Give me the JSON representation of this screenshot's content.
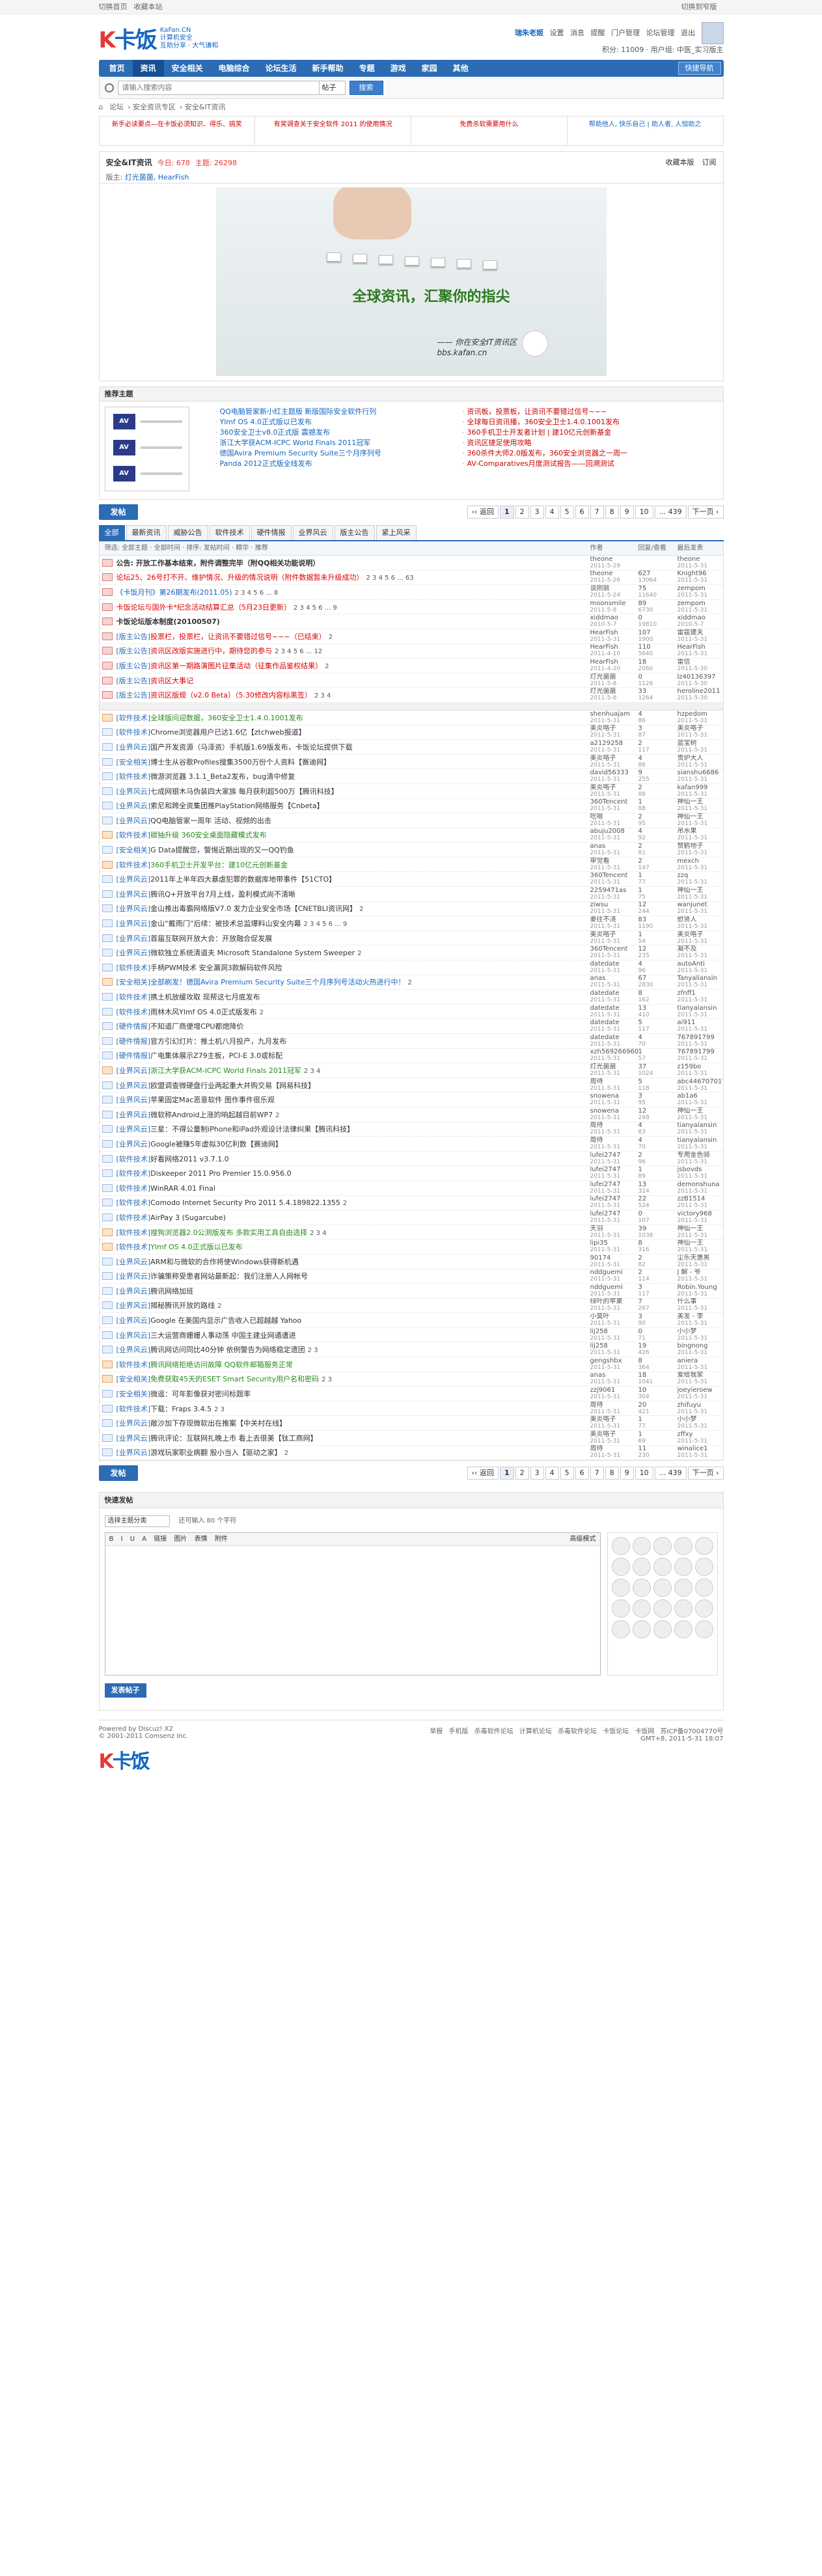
{
  "topbar": {
    "left": [
      "切换首页",
      "收藏本站"
    ],
    "right": "切换到窄版"
  },
  "logo": {
    "brand": "K卡饭",
    "sub1": "KaFan.CN",
    "sub2": "计算机安全",
    "sub3": "互助分享 · 大气谦和"
  },
  "user": {
    "name": "瑞朱老姬",
    "links": [
      "设置",
      "消息",
      "提醒",
      "门户管理",
      "论坛管理",
      "退出"
    ],
    "line2": "积分: 11009 · 用户组: 中医_实习版主"
  },
  "nav": {
    "items": [
      "首页",
      "资讯",
      "安全相关",
      "电脑综合",
      "论坛生活",
      "新手帮助",
      "专题",
      "游戏",
      "家园",
      "其他"
    ],
    "active": "资讯",
    "quick": "快捷导航"
  },
  "search": {
    "placeholder": "请输入搜索内容",
    "scope": "帖子",
    "button": "搜索"
  },
  "breadcrumb": [
    "论坛",
    "安全资讯专区",
    "安全&IT资讯"
  ],
  "banners": [
    "新手必读要点—在卡饭必须知识、得乐、搞笑",
    "有奖调查关于安全软件 2011 的使用情况",
    "免费杀软需要用什么",
    "帮助他人, 快乐自己 | 助人者, 人恒助之"
  ],
  "forum": {
    "title": "安全&IT资讯",
    "today": "今日: 678",
    "threads": "主题: 26298",
    "moderators_label": "版主:",
    "moderators": "灯光菌菌, HearFish",
    "fav": "收藏本版",
    "rss": "订阅"
  },
  "hero": {
    "slogan": "全球资讯，汇聚你的指尖",
    "caption1": "—— 你在安全IT资讯区",
    "caption2": "bbs.kafan.cn"
  },
  "theme": {
    "title": "推荐主题",
    "left": [
      "QQ电脑管家新小红主题版 新版国际安全软件行列",
      "Ylmf OS 4.0正式版以已发布",
      "360安全卫士v8.0正式版 震撼发布",
      "浙江大学获ACM-ICPC World Finals 2011冠军",
      "德国Avira Premium Security Suite三个月序列号",
      "Panda 2012正式版全线发布"
    ],
    "right": [
      "资讯板，投票板，让资讯不要错过信号~~~",
      "全球每日资讯播，360安全卫士1.4.0.1001发布",
      "360手机卫士开发者计划 | 建10亿元创新基金",
      "资讯区捷足使用攻略",
      "360杀件大师2.0版发布，360安全浏览器之一周一",
      "AV-Comparatives月度测试报告——回溯测试"
    ]
  },
  "pager": {
    "new_label": "发帖",
    "prev": "‹‹ 返回",
    "pages": [
      "1",
      "2",
      "3",
      "4",
      "5",
      "6",
      "7",
      "8",
      "9",
      "10",
      "... 439"
    ],
    "next": "下一页 ›"
  },
  "tabs": [
    "全部",
    "最新资讯",
    "威胁公告",
    "软件技术",
    "硬件情报",
    "业界风云",
    "版主公告",
    "紧上风采"
  ],
  "thead": {
    "title": "筛选: 全部主题 · 全部时间 · 排序: 发帖时间 · 精华 · 推荐",
    "author": "作者",
    "replies": "回复/查看",
    "last": "最后发表"
  },
  "threads": [
    {
      "cat": "",
      "title": "公告: 开放工作基本结束，附件调整完毕（附QQ相关功能说明）",
      "style": "bold",
      "pages": "",
      "author": "theone",
      "adate": "2011-5-29",
      "rp": "",
      "rv": "",
      "last": "theone",
      "ldate": "2011-5-31",
      "icon": "top"
    },
    {
      "cat": "",
      "title": "论坛25、26号打不开、维护情况、升级的情况说明（附件数据暂未升级成功）",
      "style": "red",
      "pages": "2 3 4 5 6 ... 63",
      "author": "theone",
      "adate": "2011-5-26",
      "rp": "627",
      "rv": "13064",
      "last": "Knight96",
      "ldate": "2011-5-31",
      "icon": "top"
    },
    {
      "cat": "",
      "title": "《卡饭月刊》第26期发布(2011.05)",
      "style": "blue",
      "pages": "2 3 4 5 6 ... 8",
      "author": "谈刚鼎",
      "adate": "2011-5-24",
      "rp": "75",
      "rv": "11640",
      "last": "zempom",
      "ldate": "2011-5-31",
      "icon": "top"
    },
    {
      "cat": "",
      "title": "卡饭论坛与国外卡*纪念活动结算汇总（5月23日更新）",
      "style": "red",
      "pages": "2 3 4 5 6 ... 9",
      "author": "moonsmile",
      "adate": "2011-5-8",
      "rp": "89",
      "rv": "6730",
      "last": "zempom",
      "ldate": "2011-5-31",
      "icon": "top"
    },
    {
      "cat": "",
      "title": "卡饭论坛版本制度(20100507)",
      "style": "bold",
      "pages": "",
      "author": "xiddmao",
      "adate": "2010-5-7",
      "rp": "0",
      "rv": "19810",
      "last": "xiddmao",
      "ldate": "2010-5-7",
      "icon": "top"
    },
    {
      "cat": "[版主公告]",
      "title": "投票栏，投票栏，让资讯不要错过信号~~~（已结束）",
      "style": "red",
      "pages": "2",
      "author": "HearFish",
      "adate": "2011-5-31",
      "rp": "107",
      "rv": "1900",
      "last": "雷霆建夫",
      "ldate": "2011-5-31",
      "icon": "top"
    },
    {
      "cat": "[版主公告]",
      "title": "资讯区改版实施进行中，期待您的参与",
      "style": "red",
      "pages": "2 3 4 5 6 ... 12",
      "author": "HearFish",
      "adate": "2011-4-10",
      "rp": "110",
      "rv": "5640",
      "last": "HearFish",
      "ldate": "2011-5-31",
      "icon": "top"
    },
    {
      "cat": "[版主公告]",
      "title": "资讯区第一期路演图片征集活动（征集作品鉴权结果）",
      "style": "red",
      "pages": "2",
      "author": "HearFish",
      "adate": "2011-4-20",
      "rp": "18",
      "rv": "2060",
      "last": "雷信",
      "ldate": "2011-5-30",
      "icon": "top"
    },
    {
      "cat": "[版主公告]",
      "title": "资讯区大事记",
      "style": "red",
      "pages": "",
      "author": "灯光菌菌",
      "adate": "2011-5-8",
      "rp": "0",
      "rv": "1126",
      "last": "lz40136397",
      "ldate": "2011-5-30",
      "icon": "top"
    },
    {
      "cat": "[版主公告]",
      "title": "资讯区版规（v2.0 Beta）（5.30修改内容标黑签）",
      "style": "red",
      "pages": "2 3 4",
      "author": "灯光菌菌",
      "adate": "2011-5-8",
      "rp": "33",
      "rv": "1264",
      "last": "heroline2011",
      "ldate": "2011-5-30",
      "icon": "top"
    },
    {
      "sep": true
    },
    {
      "cat": "[软件技术]",
      "title": "全球版问迎数据，360安全卫士1.4.0.1001发布",
      "style": "green",
      "pages": "",
      "author": "shenhuajam",
      "adate": "2011-5-31",
      "rp": "4",
      "rv": "86",
      "last": "hzpedom",
      "ldate": "2011-5-31",
      "icon": "hot"
    },
    {
      "cat": "[软件技术]",
      "title": "Chrome浏览器用户已达1.6亿【ztchweb报道】",
      "style": "",
      "pages": "",
      "author": "美炎咯子",
      "adate": "2011-5-31",
      "rp": "3",
      "rv": "87",
      "last": "美炎咯子",
      "ldate": "2011-5-31",
      "icon": ""
    },
    {
      "cat": "[业界风云]",
      "title": "国产开发资源（马泽资）手机版1.69版发布，卡饭论坛提供下载",
      "style": "",
      "pages": "",
      "author": "a2129258",
      "adate": "2011-5-31",
      "rp": "2",
      "rv": "117",
      "last": "蓝宝树",
      "ldate": "2011-5-31",
      "icon": ""
    },
    {
      "cat": "[安全相关]",
      "title": "博士生从谷歌Profiles搜集3500万份个人资料【赛迪网】",
      "style": "",
      "pages": "",
      "author": "美炎咯子",
      "adate": "2011-5-31",
      "rp": "4",
      "rv": "86",
      "last": "贵炉大人",
      "ldate": "2011-5-31",
      "icon": ""
    },
    {
      "cat": "[软件技术]",
      "title": "微游浏览器 3.1.1_Beta2发布，bug清中修复",
      "style": "",
      "pages": "",
      "author": "david56333",
      "adate": "2011-5-31",
      "rp": "9",
      "rv": "255",
      "last": "sianshu6686",
      "ldate": "2011-5-31",
      "icon": ""
    },
    {
      "cat": "[业界风云]",
      "title": "七成网银木马伪装四大家族 每月获利超500万【腾讯科技】",
      "style": "",
      "pages": "",
      "author": "美炎咯子",
      "adate": "2011-5-31",
      "rp": "2",
      "rv": "88",
      "last": "kafan999",
      "ldate": "2011-5-31",
      "icon": ""
    },
    {
      "cat": "[业界风云]",
      "title": "索尼和跨全资集团推PlayStation网络服务【Cnbeta】",
      "style": "",
      "pages": "",
      "author": "360Tencent",
      "adate": "2011-5-31",
      "rp": "1",
      "rv": "88",
      "last": "神仙一王",
      "ldate": "2011-5-31",
      "icon": ""
    },
    {
      "cat": "[业界风云]",
      "title": "QQ电脑管家一周年 活动、视频的出击",
      "style": "",
      "pages": "",
      "author": "吃嗯",
      "adate": "2011-5-31",
      "rp": "2",
      "rv": "95",
      "last": "神仙一王",
      "ldate": "2011-5-31",
      "icon": ""
    },
    {
      "cat": "[软件技术]",
      "title": "碳抽升级 360安全桌面隐藏模式发布",
      "style": "green",
      "pages": "",
      "author": "abuju2008",
      "adate": "2011-5-31",
      "rp": "4",
      "rv": "92",
      "last": "吊水果",
      "ldate": "2011-5-31",
      "icon": "hot"
    },
    {
      "cat": "[安全相关]",
      "title": "G Data提醒您，警惕近期出现的又一QQ钓鱼",
      "style": "",
      "pages": "",
      "author": "anas",
      "adate": "2011-5-31",
      "rp": "2",
      "rv": "81",
      "last": "赞鹤地子",
      "ldate": "2011-5-31",
      "icon": ""
    },
    {
      "cat": "[软件技术]",
      "title": "360手机卫士开发平台：建10亿元创新基金",
      "style": "green",
      "pages": "",
      "author": "审觉看",
      "adate": "2011-5-31",
      "rp": "2",
      "rv": "147",
      "last": "mexch",
      "ldate": "2011-5-31",
      "icon": "hot"
    },
    {
      "cat": "[业界风云]",
      "title": "2011年上半年四大暴虐犯罪的数据库地带事件【51CTO】",
      "style": "",
      "pages": "",
      "author": "360Tencent",
      "adate": "2011-5-31",
      "rp": "1",
      "rv": "77",
      "last": "zzq",
      "ldate": "2011-5-31",
      "icon": ""
    },
    {
      "cat": "[业界风云]",
      "title": "腾讯Q+开放平台7月上线，盈利模式尚不清晰",
      "style": "",
      "pages": "",
      "author": "2259471as",
      "adate": "2011-5-31",
      "rp": "1",
      "rv": "75",
      "last": "神仙一王",
      "ldate": "2011-5-31",
      "icon": ""
    },
    {
      "cat": "[业界风云]",
      "title": "金山推出毒霸网络版V7.0 发力企业安全市场【CNETBLI资讯网】",
      "style": "",
      "pages": "2",
      "author": "ziwsu",
      "adate": "2011-5-31",
      "rp": "12",
      "rv": "244",
      "last": "wanjunet",
      "ldate": "2011-5-31",
      "icon": ""
    },
    {
      "cat": "[业界风云]",
      "title": "金山“戴雨门”后续：被技术总监爆料山安全内幕",
      "style": "",
      "pages": "2 3 4 5 6 ... 9",
      "author": "要往不浇",
      "adate": "2011-5-31",
      "rp": "83",
      "rv": "1190",
      "last": "慰贤人",
      "ldate": "2011-5-31",
      "icon": ""
    },
    {
      "cat": "[业界风云]",
      "title": "首届互联网开放大会：开放融合促发展",
      "style": "",
      "pages": "",
      "author": "美炎咯子",
      "adate": "2011-5-31",
      "rp": "1",
      "rv": "54",
      "last": "美炎咯子",
      "ldate": "2011-5-31",
      "icon": ""
    },
    {
      "cat": "[业界风云]",
      "title": "微软独立系统清道夫 Microsoft Standalone System Sweeper",
      "style": "",
      "pages": "2",
      "author": "360Tencent",
      "adate": "2011-5-31",
      "rp": "12",
      "rv": "235",
      "last": "凝不及",
      "ldate": "2011-5-31",
      "icon": ""
    },
    {
      "cat": "[软件技术]",
      "title": "手柄PWM技术 安全漏洞3款解码软件风险",
      "style": "",
      "pages": "",
      "author": "datedate",
      "adate": "2011-5-31",
      "rp": "4",
      "rv": "96",
      "last": "autoAnti",
      "ldate": "2011-5-31",
      "icon": ""
    },
    {
      "cat": "[安全相关]",
      "title": "全部刷发！德国Avira Premium Security Suite三个月序列号活动火热进行中！",
      "style": "blue",
      "pages": "2",
      "author": "anas",
      "adate": "2011-5-31",
      "rp": "67",
      "rv": "2830",
      "last": "Tanyaliansin",
      "ldate": "2011-5-31",
      "icon": "hot"
    },
    {
      "cat": "[软件技术]",
      "title": "携土机放缓攻取 现帮这七月底发布",
      "style": "",
      "pages": "",
      "author": "datedate",
      "adate": "2011-5-31",
      "rp": "8",
      "rv": "162",
      "last": "zfnff1",
      "ldate": "2011-5-31",
      "icon": ""
    },
    {
      "cat": "[软件技术]",
      "title": "雨林木风Ylmf OS 4.0正式版发布",
      "style": "",
      "pages": "2",
      "author": "datedate",
      "adate": "2011-5-31",
      "rp": "13",
      "rv": "410",
      "last": "tianyalansin",
      "ldate": "2011-5-31",
      "icon": ""
    },
    {
      "cat": "[硬件情报]",
      "title": "不知道厂商便增CPU都熄降价",
      "style": "",
      "pages": "",
      "author": "datedate",
      "adate": "2011-5-31",
      "rp": "5",
      "rv": "117",
      "last": "ai911",
      "ldate": "2011-5-31",
      "icon": ""
    },
    {
      "cat": "[硬件情报]",
      "title": "官方引幻灯片：推土机八月投产，九月发布",
      "style": "",
      "pages": "",
      "author": "datedate",
      "adate": "2011-5-31",
      "rp": "4",
      "rv": "70",
      "last": "767891799",
      "ldate": "2011-5-31",
      "icon": ""
    },
    {
      "cat": "[硬件情报]",
      "title": "广电集体展示Z79主板，PCI-E 3.0或标配",
      "style": "",
      "pages": "",
      "author": "xzh569266960",
      "adate": "2011-5-31",
      "rp": "1",
      "rv": "57",
      "last": "767891799",
      "ldate": "2011-5-31",
      "icon": ""
    },
    {
      "cat": "[业界风云]",
      "title": "浙江大学获ACM-ICPC World Finals 2011冠军",
      "style": "green",
      "pages": "2 3 4",
      "author": "灯光菌菌",
      "adate": "2011-5-31",
      "rp": "37",
      "rv": "1024",
      "last": "z159bo",
      "ldate": "2011-5-31",
      "icon": "hot"
    },
    {
      "cat": "[业界风云]",
      "title": "欧盟调查微硬盘行业两起重大并购交易【网易科技】",
      "style": "",
      "pages": "",
      "author": "周待",
      "adate": "2011-5-31",
      "rp": "5",
      "rv": "118",
      "last": "abc446707017",
      "ldate": "2011-5-31",
      "icon": ""
    },
    {
      "cat": "[业界风云]",
      "title": "苹果固定Mac恶意软件 图作事件很乐观",
      "style": "",
      "pages": "",
      "author": "snowena",
      "adate": "2011-5-31",
      "rp": "3",
      "rv": "95",
      "last": "ab1a6",
      "ldate": "2011-5-31",
      "icon": ""
    },
    {
      "cat": "[业界风云]",
      "title": "微软称Android上涨的响起越目前WP7",
      "style": "",
      "pages": "2",
      "author": "snowena",
      "adate": "2011-5-31",
      "rp": "12",
      "rv": "248",
      "last": "神仙一王",
      "ldate": "2011-5-31",
      "icon": ""
    },
    {
      "cat": "[业界风云]",
      "title": "三星：不得公量制iPhone和iPad外观设计法律纠果【腾讯科技】",
      "style": "",
      "pages": "",
      "author": "周待",
      "adate": "2011-5-31",
      "rp": "4",
      "rv": "83",
      "last": "tianyalansin",
      "ldate": "2011-5-31",
      "icon": ""
    },
    {
      "cat": "[业界风云]",
      "title": "Google被赚5年虚拟30亿利数【赛迪网】",
      "style": "",
      "pages": "",
      "author": "周待",
      "adate": "2011-5-31",
      "rp": "4",
      "rv": "70",
      "last": "tianyalansin",
      "ldate": "2011-5-31",
      "icon": ""
    },
    {
      "cat": "[软件技术]",
      "title": "好看网络2011 v3.7.1.0",
      "style": "",
      "pages": "",
      "author": "lufei2747",
      "adate": "2011-5-31",
      "rp": "2",
      "rv": "96",
      "last": "专用金色骑",
      "ldate": "2011-5-31",
      "icon": ""
    },
    {
      "cat": "[软件技术]",
      "title": "Diskeeper 2011 Pro Premier 15.0.956.0",
      "style": "",
      "pages": "",
      "author": "lufei2747",
      "adate": "2011-5-31",
      "rp": "1",
      "rv": "89",
      "last": "jsbovds",
      "ldate": "2011-5-31",
      "icon": ""
    },
    {
      "cat": "[软件技术]",
      "title": "WinRAR 4.01 Final",
      "style": "",
      "pages": "",
      "author": "lufei2747",
      "adate": "2011-5-31",
      "rp": "13",
      "rv": "324",
      "last": "demonshuna",
      "ldate": "2011-5-31",
      "icon": ""
    },
    {
      "cat": "[软件技术]",
      "title": "Comodo Internet Security Pro 2011 5.4.189822.1355",
      "style": "",
      "pages": "2",
      "author": "lufei2747",
      "adate": "2011-5-31",
      "rp": "22",
      "rv": "524",
      "last": "zzB1514",
      "ldate": "2011-5-31",
      "icon": ""
    },
    {
      "cat": "[软件技术]",
      "title": "AirPay 3 (Sugarcube)",
      "style": "",
      "pages": "",
      "author": "lufei2747",
      "adate": "2011-5-31",
      "rp": "0",
      "rv": "107",
      "last": "victory968",
      "ldate": "2011-5-31",
      "icon": ""
    },
    {
      "cat": "[软件技术]",
      "title": "搜狗浏览器2.0公测版发布 多款实用工具自由选择",
      "style": "green",
      "pages": "2 3 4",
      "author": "天羽",
      "adate": "2011-5-31",
      "rp": "39",
      "rv": "1038",
      "last": "神仙一王",
      "ldate": "2011-5-31",
      "icon": "hot"
    },
    {
      "cat": "[软件技术]",
      "title": "Ylmf OS 4.0正式版以已发布",
      "style": "green",
      "pages": "",
      "author": "lipi35",
      "adate": "2011-5-31",
      "rp": "8",
      "rv": "316",
      "last": "神仙一王",
      "ldate": "2011-5-31",
      "icon": "hot"
    },
    {
      "cat": "[业界风云]",
      "title": "ARM和与微软的合作将使Windows获得新机遇",
      "style": "",
      "pages": "",
      "author": "90174",
      "adate": "2011-5-31",
      "rp": "2",
      "rv": "82",
      "last": "尘乐天惠黑",
      "ldate": "2011-5-31",
      "icon": ""
    },
    {
      "cat": "[业界风云]",
      "title": "诈骗策称受患者网站最新起：我们注册人人网帐号",
      "style": "",
      "pages": "",
      "author": "nddguemi",
      "adate": "2011-5-31",
      "rp": "2",
      "rv": "114",
      "last": "J 解 - 爷",
      "ldate": "2011-5-31",
      "icon": ""
    },
    {
      "cat": "[业界风云]",
      "title": "腾讯网络加班",
      "style": "",
      "pages": "",
      "author": "nddguemi",
      "adate": "2011-5-31",
      "rp": "3",
      "rv": "117",
      "last": "Robin.Young",
      "ldate": "2011-5-31",
      "icon": ""
    },
    {
      "cat": "[业界风云]",
      "title": "揭秘腾讯开放的路线",
      "style": "",
      "pages": "2",
      "author": "绿叶的苹果",
      "adate": "2011-5-31",
      "rp": "7",
      "rv": "267",
      "last": "什么事",
      "ldate": "2011-5-31",
      "icon": ""
    },
    {
      "cat": "[业界风云]",
      "title": "Google 在美国内显示广告收入已超越越 Yahoo",
      "style": "",
      "pages": "",
      "author": "小莫叶",
      "adate": "2011-5-31",
      "rp": "3",
      "rv": "90",
      "last": "美发 - 李",
      "ldate": "2011-5-31",
      "icon": ""
    },
    {
      "cat": "[业界风云]",
      "title": "三大运营商姗姗人事动荡 中国主建业网通遭进",
      "style": "",
      "pages": "",
      "author": "lij258",
      "adate": "2011-5-31",
      "rp": "0",
      "rv": "71",
      "last": "小小梦",
      "ldate": "2011-5-31",
      "icon": ""
    },
    {
      "cat": "[业界风云]",
      "title": "腾讯网访问同比40分钟 依例警告为网络稳定遗团",
      "style": "",
      "pages": "2 3",
      "author": "lij258",
      "adate": "2011-5-31",
      "rp": "19",
      "rv": "426",
      "last": "bingnong",
      "ldate": "2011-5-31",
      "icon": ""
    },
    {
      "cat": "[软件技术]",
      "title": "腾讯网络拒绝访问故障 QQ软件邮箱服务正常",
      "style": "green",
      "pages": "",
      "author": "gengshbx",
      "adate": "2011-5-31",
      "rp": "8",
      "rv": "364",
      "last": "aniera",
      "ldate": "2011-5-31",
      "icon": "hot"
    },
    {
      "cat": "[安全相关]",
      "title": "免费获取45天的ESET Smart Security用户名和密码",
      "style": "green",
      "pages": "2 3",
      "author": "anas",
      "adate": "2011-5-31",
      "rp": "18",
      "rv": "1041",
      "last": "爱给我家",
      "ldate": "2011-5-31",
      "icon": "hot"
    },
    {
      "cat": "[安全相关]",
      "title": "微遥：可年影像获对密问标题率",
      "style": "",
      "pages": "",
      "author": "zzj9061",
      "adate": "2011-5-31",
      "rp": "10",
      "rv": "304",
      "last": "joeyieroew",
      "ldate": "2011-5-31",
      "icon": ""
    },
    {
      "cat": "[软件技术]",
      "title": "下载：Fraps 3.4.5",
      "style": "",
      "pages": "2 3",
      "author": "周待",
      "adate": "2011-5-31",
      "rp": "20",
      "rv": "421",
      "last": "zhifuyu",
      "ldate": "2011-5-31",
      "icon": ""
    },
    {
      "cat": "[业界风云]",
      "title": "敞沙加下存现微软出在推案【中关村在线】",
      "style": "",
      "pages": "",
      "author": "美炎咯子",
      "adate": "2011-5-31",
      "rp": "1",
      "rv": "77",
      "last": "小小梦",
      "ldate": "2011-5-31",
      "icon": ""
    },
    {
      "cat": "[业界风云]",
      "title": "腾讯评论：互联网扎晚上市 看上去很美【钛工商网】",
      "style": "",
      "pages": "",
      "author": "美炎咯子",
      "adate": "2011-5-31",
      "rp": "1",
      "rv": "69",
      "last": "zffxy",
      "ldate": "2011-5-31",
      "icon": ""
    },
    {
      "cat": "[业界风云]",
      "title": "游戏玩家职业病翻 股小当入【驱动之家】",
      "style": "",
      "pages": "2",
      "author": "周待",
      "adate": "2011-5-31",
      "rp": "11",
      "rv": "230",
      "last": "winalice1",
      "ldate": "2011-5-31",
      "icon": ""
    }
  ],
  "reply": {
    "title": "快速发帖",
    "select": "选择主题分类",
    "tip": "还可输入 80 个字符",
    "toolbar": [
      "B",
      "I",
      "U",
      "A",
      "链接",
      "图片",
      "表情",
      "附件"
    ],
    "smiles_label": "高级模式",
    "post": "发表帖子"
  },
  "footer": {
    "powered": "Powered by Discuz! X2",
    "copyright": "© 2001-2011 Comsenz Inc.",
    "links": [
      "举报",
      "手机版",
      "杀毒软件论坛",
      "计算机论坛",
      "杀毒软件论坛",
      "卡饭论坛",
      "卡饭网"
    ],
    "icp": "苏ICP备07004770号",
    "time": "GMT+8, 2011-5-31 18:07"
  }
}
